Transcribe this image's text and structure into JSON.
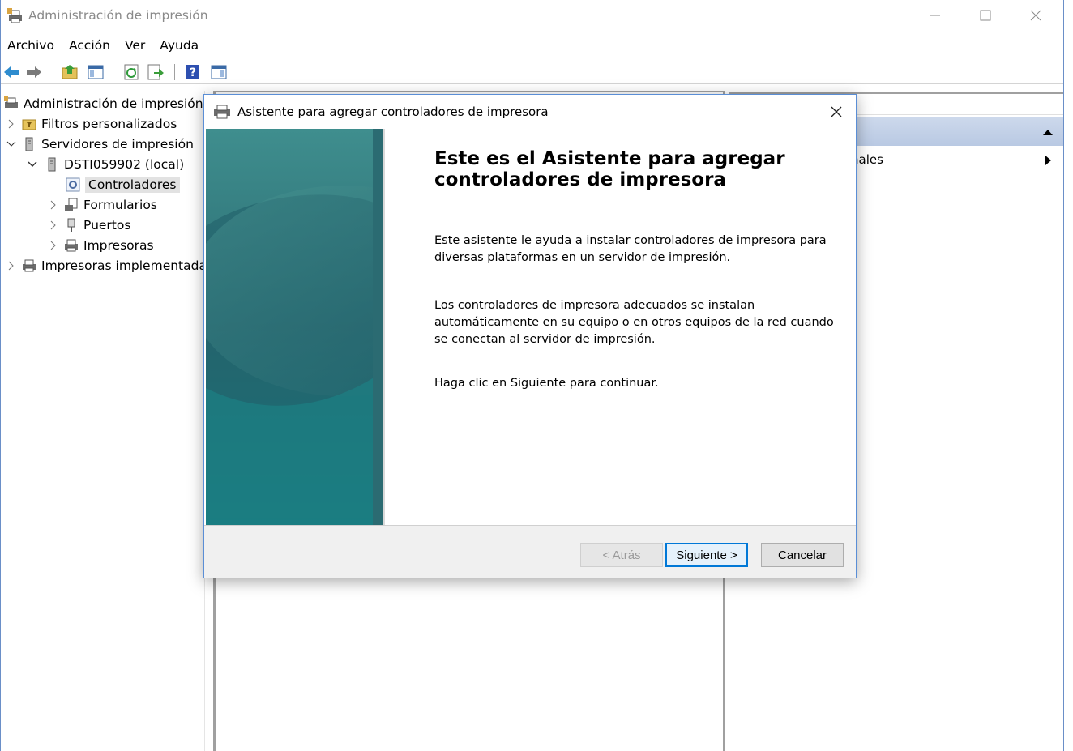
{
  "window": {
    "title": "Administración de impresión"
  },
  "menu": [
    {
      "label": "Archivo"
    },
    {
      "label": "Acción"
    },
    {
      "label": "Ver"
    },
    {
      "label": "Ayuda"
    }
  ],
  "tree": {
    "root": "Administración de impresión",
    "filters": "Filtros personalizados",
    "servers": "Servidores de impresión",
    "server": "DSTI059902 (local)",
    "drivers": "Controladores",
    "forms": "Formularios",
    "ports": "Puertos",
    "printers": "Impresoras",
    "deployed": "Impresoras implementada"
  },
  "actions": {
    "item": "nales"
  },
  "dialog": {
    "title": "Asistente para agregar controladores de impresora",
    "heading": "Este es el Asistente para agregar controladores de impresora",
    "p1": "Este asistente le ayuda a instalar controladores de impresora para diversas plataformas en un servidor de impresión.",
    "p2": "Los controladores de impresora adecuados se instalan automáticamente en su equipo o en otros equipos de la red cuando se conectan al servidor de impresión.",
    "p3": "Haga clic en Siguiente para continuar.",
    "back": "< Atrás",
    "next": "Siguiente >",
    "cancel": "Cancelar"
  },
  "colors": {
    "accent": "#0078d7",
    "wizard_panel": "#1f6f78"
  }
}
